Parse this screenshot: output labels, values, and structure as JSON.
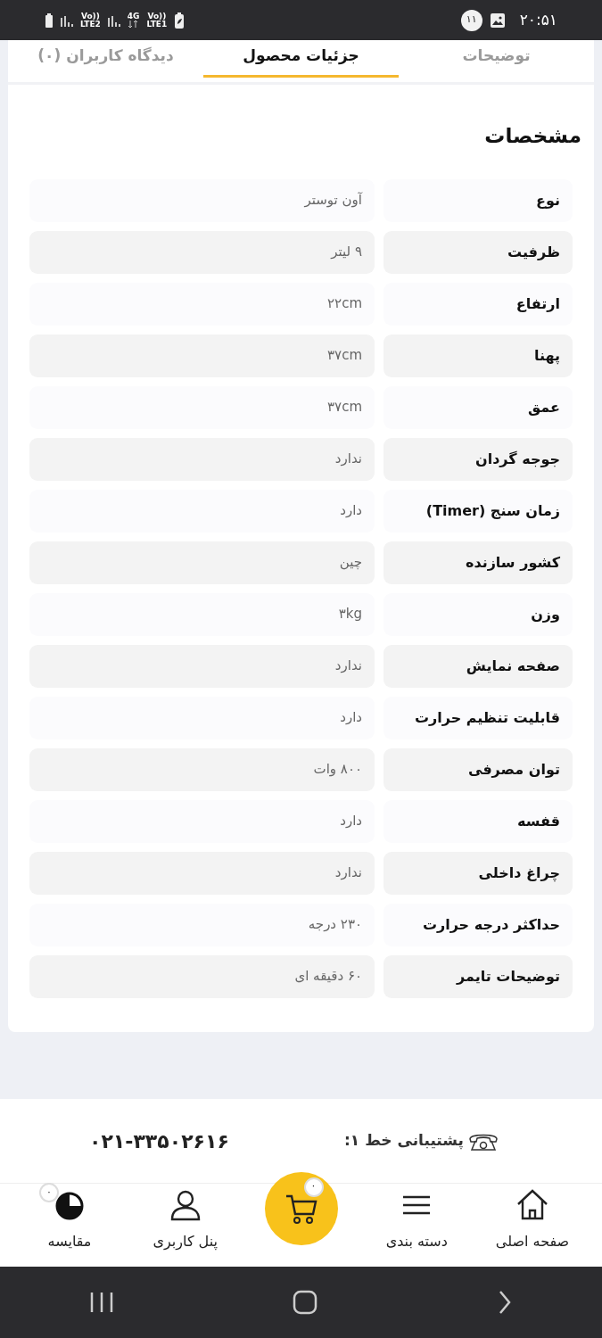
{
  "status_bar": {
    "time": "۲۰:۵۱",
    "notification_count": "۱۱",
    "sim2": {
      "voice": "Vo))",
      "network": "LTE2"
    },
    "sim1": {
      "data": "4G",
      "voice": "Vo))",
      "network": "LTE1"
    }
  },
  "tabs": [
    {
      "label": "توضیحات",
      "selected": false
    },
    {
      "label": "جزئیات محصول",
      "selected": true
    },
    {
      "label": "دیدگاه کاربران (۰)",
      "selected": false
    }
  ],
  "specs": {
    "title": "مشخصات",
    "rows": [
      {
        "label": "نوع",
        "value": "آون توستر"
      },
      {
        "label": "ظرفیت",
        "value": "۹ لیتر"
      },
      {
        "label": "ارتفاع",
        "value": "۲۲cm"
      },
      {
        "label": "پهنا",
        "value": "۳۷cm"
      },
      {
        "label": "عمق",
        "value": "۳۷cm"
      },
      {
        "label": "جوجه گردان",
        "value": "ندارد"
      },
      {
        "label": "زمان سنج (Timer)",
        "value": "دارد"
      },
      {
        "label": "کشور سازنده",
        "value": "چین"
      },
      {
        "label": "وزن",
        "value": "۳kg"
      },
      {
        "label": "صفحه نمایش",
        "value": "ندارد"
      },
      {
        "label": "قابلیت تنظیم حرارت",
        "value": "دارد"
      },
      {
        "label": "توان مصرفی",
        "value": "۸۰۰ وات"
      },
      {
        "label": "قفسه",
        "value": "دارد"
      },
      {
        "label": "چراغ داخلی",
        "value": "ندارد"
      },
      {
        "label": "حداکثر درجه حرارت",
        "value": "۲۳۰ درجه"
      },
      {
        "label": "توضیحات تایمر",
        "value": "۶۰ دقیقه ای"
      }
    ]
  },
  "support": {
    "label": "پشتیبانی خط ۱:",
    "phone": "۰۲۱-۳۳۵۰۲۶۱۶"
  },
  "bottom_nav": [
    {
      "kind": "home",
      "label": "صفحه اصلی"
    },
    {
      "kind": "menu",
      "label": "دسته بندی"
    },
    {
      "kind": "cart",
      "badge": "۰"
    },
    {
      "kind": "user",
      "label": "پنل کاربری"
    },
    {
      "kind": "compare",
      "label": "مقایسه",
      "badge": "۰"
    }
  ]
}
